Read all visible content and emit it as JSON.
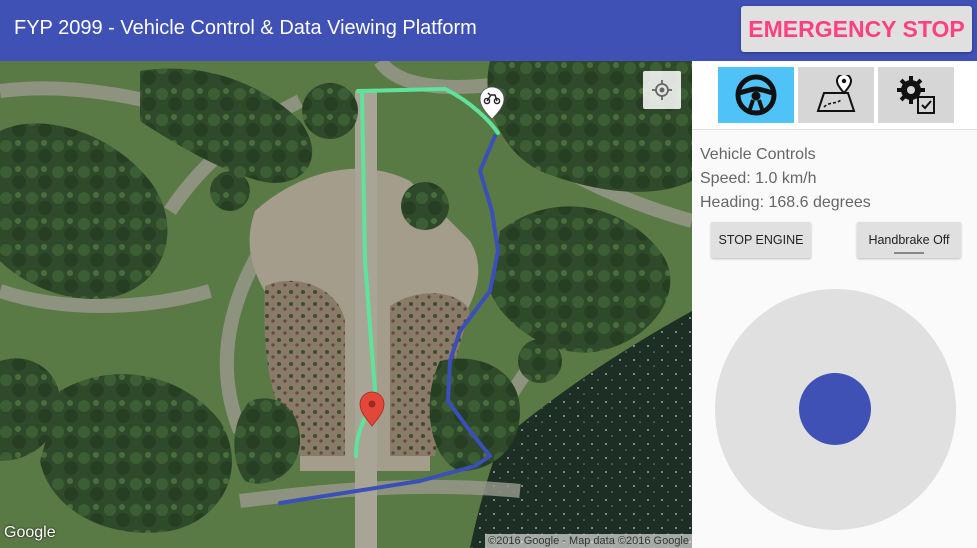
{
  "app": {
    "title": "FYP 2099 - Vehicle Control & Data Viewing Platform"
  },
  "header": {
    "emergency_stop_label": "EMERGENCY STOP"
  },
  "map": {
    "logo_text": "Google",
    "attribution": "©2016 Google - Map data ©2016 Google"
  },
  "tabs": [
    {
      "icon": "steering-wheel-icon",
      "active": true
    },
    {
      "icon": "map-route-icon",
      "active": false
    },
    {
      "icon": "settings-gears-icon",
      "active": false
    }
  ],
  "controls": {
    "heading_label": "Vehicle Controls",
    "speed_text": "Speed: 1.0  km/h",
    "heading_text": "Heading: 168.6 degrees",
    "stop_engine_label": "STOP ENGINE",
    "handbrake_label": "Handbrake Off"
  },
  "colors": {
    "primary": "#3f51b5",
    "accent": "#ff4081",
    "active_tab": "#4fc3f7",
    "track_green": "#5fe39a",
    "track_blue": "#3a4fb8",
    "marker_red": "#e2473a"
  }
}
